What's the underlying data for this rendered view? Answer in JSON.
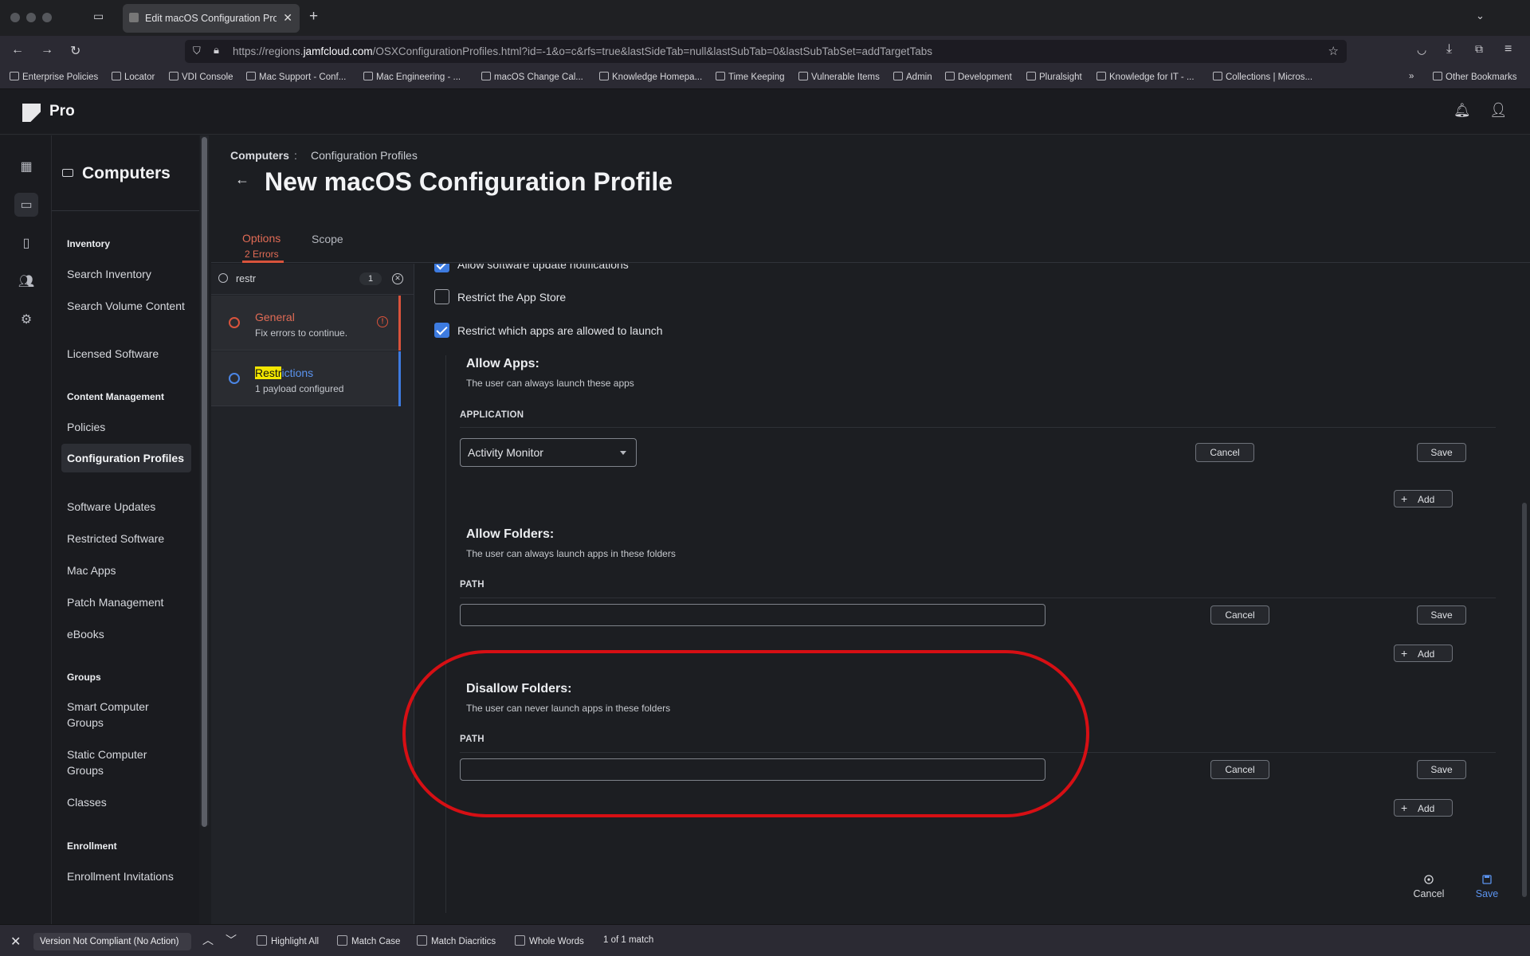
{
  "browser": {
    "tab_title": "Edit macOS Configuration Profile",
    "url_prefix": "https://regions.",
    "url_domain": "jamfcloud.com",
    "url_rest": "/OSXConfigurationProfiles.html?id=-1&o=c&rfs=true&lastSideTab=null&lastSubTab=0&lastSubTabSet=addTargetTabs",
    "bookmarks": [
      "Enterprise Policies",
      "Locator",
      "VDI Console",
      "Mac Support - Conf...",
      "Mac Engineering - ...",
      "macOS Change Cal...",
      "Knowledge Homepa...",
      "Time Keeping",
      "Vulnerable Items",
      "Admin",
      "Development",
      "Pluralsight",
      "Knowledge for IT - ...",
      "Collections | Micros..."
    ],
    "other_bookmarks": "Other Bookmarks"
  },
  "app": {
    "brand": "Pro"
  },
  "sidebar": {
    "title": "Computers",
    "sections": [
      {
        "heading": "Inventory",
        "items": [
          "Search Inventory",
          "Search Volume Content",
          "Licensed Software"
        ]
      },
      {
        "heading": "Content Management",
        "items": [
          "Policies",
          "Configuration Profiles",
          "Software Updates",
          "Restricted Software",
          "Mac Apps",
          "Patch Management",
          "eBooks"
        ]
      },
      {
        "heading": "Groups",
        "items": [
          "Smart Computer Groups",
          "Static Computer Groups",
          "Classes"
        ]
      },
      {
        "heading": "Enrollment",
        "items": [
          "Enrollment Invitations"
        ]
      }
    ],
    "active_item": "Configuration Profiles"
  },
  "header": {
    "breadcrumb_root": "Computers",
    "breadcrumb_sep": ":",
    "breadcrumb_current": "Configuration Profiles",
    "page_title": "New macOS Configuration Profile",
    "tabs": [
      {
        "label": "Options",
        "sub": "2 Errors"
      },
      {
        "label": "Scope"
      }
    ]
  },
  "payloads": {
    "search_value": "restr",
    "match_count": "1",
    "items": [
      {
        "title": "General",
        "sub": "Fix errors to continue."
      },
      {
        "title_highlight": "Restr",
        "title_rest": "ictions",
        "sub": "1 payload configured"
      }
    ]
  },
  "form": {
    "checks": [
      {
        "label": "Allow software update notifications",
        "checked": true
      },
      {
        "label": "Restrict the App Store",
        "checked": false
      },
      {
        "label": "Restrict which apps are allowed to launch",
        "checked": true
      }
    ],
    "allow_apps": {
      "title": "Allow Apps:",
      "desc": "The user can always launch these apps",
      "column": "APPLICATION",
      "selected_app": "Activity Monitor"
    },
    "allow_folders": {
      "title": "Allow Folders:",
      "desc": "The user can always launch apps in these folders",
      "column": "PATH",
      "path_value": ""
    },
    "disallow_folders": {
      "title": "Disallow Folders:",
      "desc": "The user can never launch apps in these folders",
      "column": "PATH",
      "path_value": ""
    },
    "cancel_label": "Cancel",
    "save_label": "Save",
    "add_label": "Add"
  },
  "footer": {
    "cancel": "Cancel",
    "save": "Save"
  },
  "findbar": {
    "query": "Version Not Compliant (No Action)",
    "options": [
      "Highlight All",
      "Match Case",
      "Match Diacritics",
      "Whole Words"
    ],
    "status": "1 of 1 match"
  },
  "colors": {
    "accent_red": "#e06b55",
    "accent_blue": "#3d7be0",
    "annotation": "#d60f14"
  }
}
